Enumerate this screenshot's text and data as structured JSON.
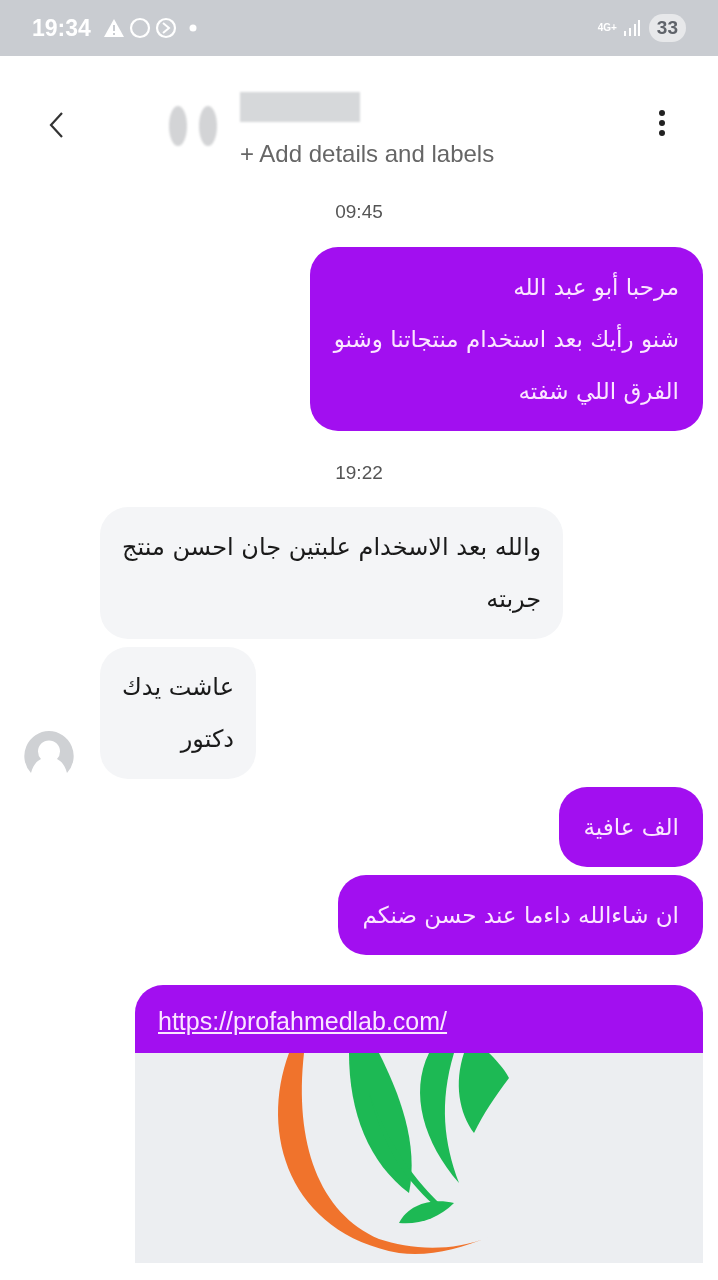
{
  "status_bar": {
    "time": "19:34",
    "network": "4G+",
    "battery": "33"
  },
  "header": {
    "subtitle": "+ Add details and labels"
  },
  "messages": [
    {
      "kind": "time",
      "text": "09:45"
    },
    {
      "kind": "outgoing",
      "text": "مرحبا أبو عبد الله\nشنو رأيك بعد استخدام منتجاتنا وشنو\nالفرق اللي شفته"
    },
    {
      "kind": "time",
      "text": "19:22"
    },
    {
      "kind": "incoming",
      "text": "والله بعد الاسخدام علبتين جان احسن منتج\nجربته",
      "avatar": false
    },
    {
      "kind": "incoming",
      "text": "عاشت يدك\nدكتور",
      "avatar": true
    },
    {
      "kind": "outgoing",
      "text": "الف عافية"
    },
    {
      "kind": "outgoing",
      "text": "ان شاءالله داءما عند حسن ضنكم"
    },
    {
      "kind": "link",
      "url": "https://profahmedlab.com/"
    }
  ]
}
